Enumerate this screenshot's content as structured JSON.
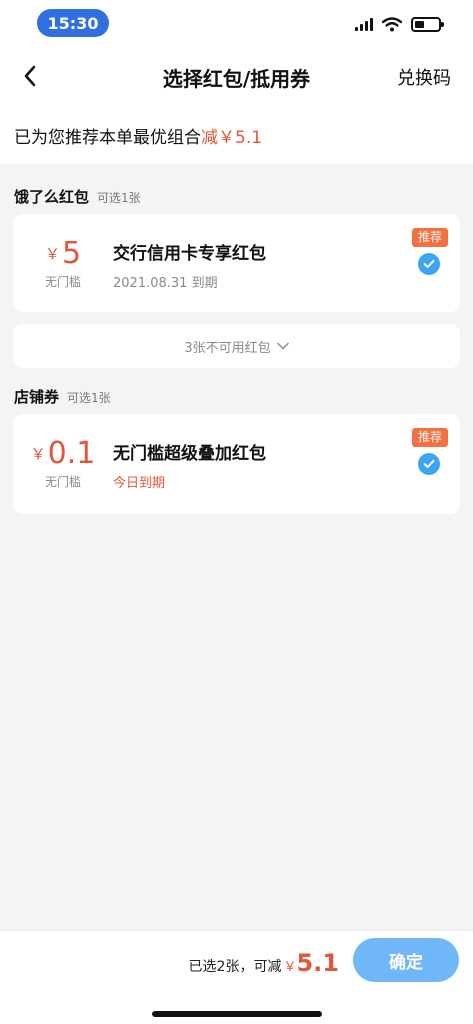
{
  "status_bar": {
    "time": "15:30"
  },
  "nav": {
    "title": "选择红包/抵用券",
    "action": "兑换码"
  },
  "summary": {
    "text": "已为您推荐本单最优组合",
    "discount": "减￥5.1"
  },
  "eleme_section": {
    "title": "饿了么红包",
    "subtitle": "可选1张",
    "card": {
      "currency": "￥",
      "amount": "5",
      "threshold": "无门槛",
      "title": "交行信用卡专享红包",
      "expiry": "2021.08.31 到期",
      "badge": "推荐",
      "selected": true
    },
    "unavailable": "3张不可用红包"
  },
  "shop_section": {
    "title": "店铺券",
    "subtitle": "可选1张",
    "card": {
      "currency": "￥",
      "amount": "0.1",
      "threshold": "无门槛",
      "title": "无门槛超级叠加红包",
      "expiry": "今日到期",
      "badge": "推荐",
      "selected": true
    }
  },
  "footer": {
    "selected_text": "已选2张，可减",
    "currency": "￥",
    "total": "5.1",
    "confirm": "确定"
  },
  "colors": {
    "accent": "#e4563a",
    "badge": "#f5703f",
    "check": "#3ba5f3",
    "confirm": "#6fb7f8",
    "time_pill": "#2f6fe0"
  }
}
